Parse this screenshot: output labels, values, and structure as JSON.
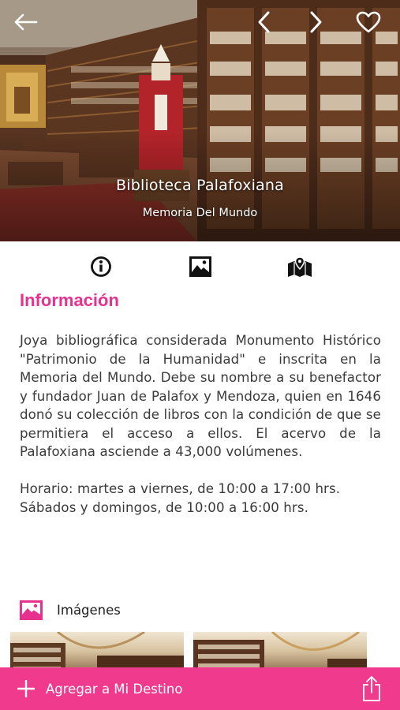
{
  "hero": {
    "title": "Biblioteca Palafoxiana",
    "subtitle": "Memoria Del Mundo"
  },
  "nav": {
    "back_icon": "arrow-left-icon",
    "prev_icon": "chevron-left-icon",
    "next_icon": "chevron-right-icon",
    "favorite_icon": "heart-outline-icon"
  },
  "tabs": [
    {
      "name": "info",
      "icon": "info-circle-icon"
    },
    {
      "name": "images",
      "icon": "image-icon"
    },
    {
      "name": "map",
      "icon": "map-pin-icon"
    }
  ],
  "info": {
    "title": "Información",
    "paragraph": "Joya bibliográfica considerada Monumento Histórico \"Patrimonio de la Humanidad\" e inscrita en la Memoria del Mundo. Debe su nombre a su benefactor y fundador Juan de Palafox y Mendoza, quien en 1646 donó su colección de libros con la condición de que se permitiera el acceso a ellos. El acervo de la Palafoxiana asciende a 43,000 volúmenes.",
    "hours_line1": "Horario: martes a viernes, de 10:00 a 17:00 hrs.",
    "hours_line2": "Sábados y domingos, de 10:00 a 16:00 hrs."
  },
  "images_section": {
    "label": "Imágenes",
    "icon": "image-icon"
  },
  "bottom_bar": {
    "add_label": "Agregar a Mi Destino",
    "add_icon": "plus-icon",
    "share_icon": "share-icon"
  },
  "colors": {
    "accent": "#e8318f",
    "bar": "#ef3a8e"
  }
}
